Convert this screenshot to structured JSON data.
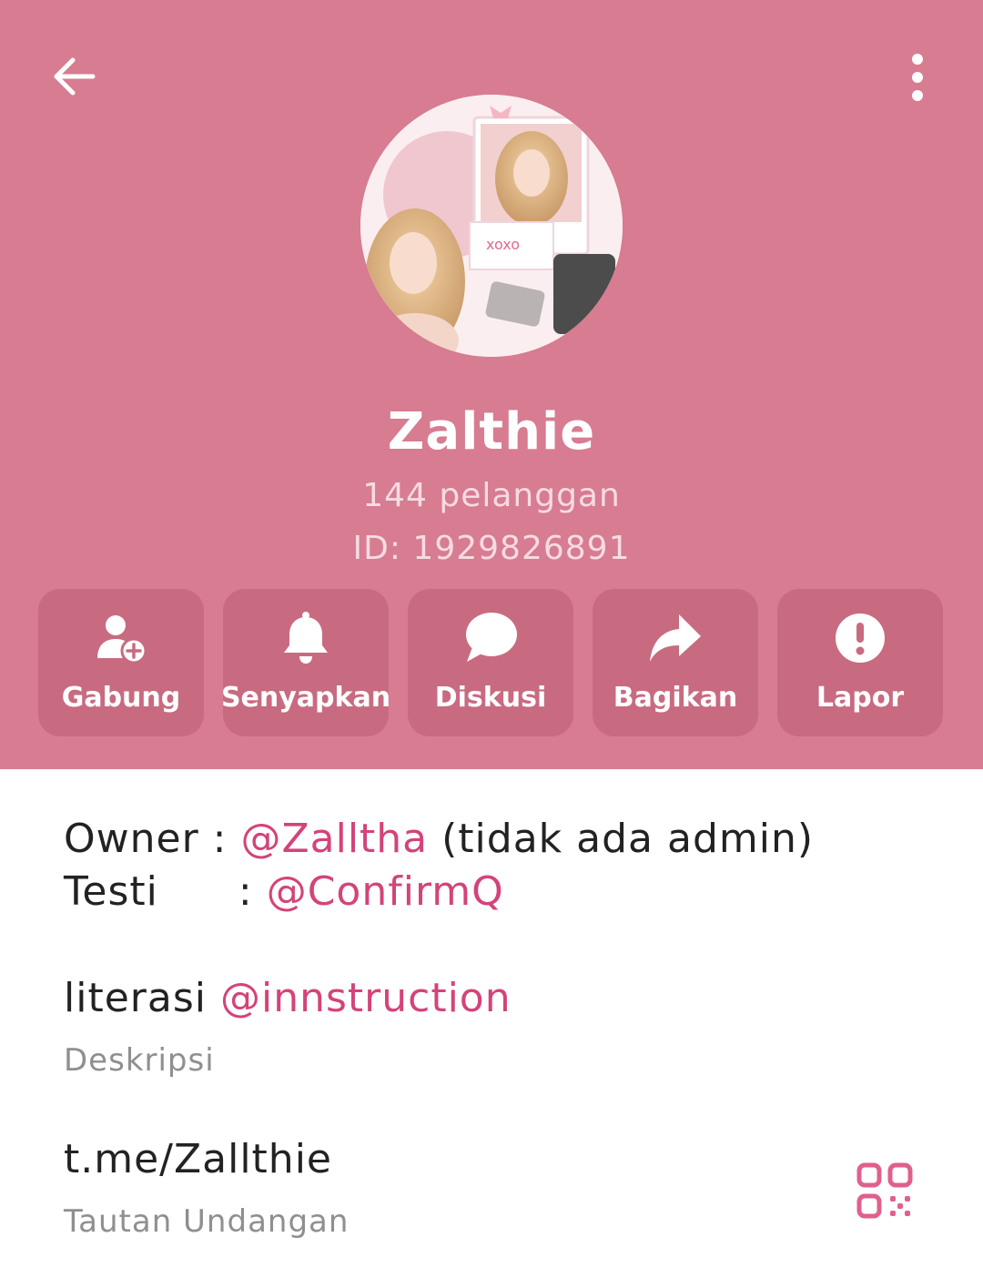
{
  "channel": {
    "name": "Zalthie",
    "subscribers": "144 pelanggan",
    "id_text": "ID: 1929826891"
  },
  "toolbar": {
    "back_icon": "arrow-left-icon",
    "more_icon": "more-vertical-icon"
  },
  "actions": [
    {
      "label": "Gabung",
      "icon": "add-user-icon"
    },
    {
      "label": "Senyapkan",
      "icon": "bell-icon"
    },
    {
      "label": "Diskusi",
      "icon": "chat-bubble-icon"
    },
    {
      "label": "Bagikan",
      "icon": "share-arrow-icon"
    },
    {
      "label": "Lapor",
      "icon": "alert-icon"
    }
  ],
  "description": {
    "owner_label": "Owner :",
    "owner_link": "@Zalltha",
    "owner_note": "(tidak ada admin)",
    "testi_label": "Testi",
    "testi_colon": ":",
    "testi_link": "@ConfirmQ",
    "literasi_label": "literasi",
    "literasi_link": "@innstruction",
    "caption": "Deskripsi"
  },
  "invite": {
    "link": "t.me/Zallthie",
    "caption": "Tautan Undangan",
    "qr_icon": "qr-code-icon"
  },
  "colors": {
    "header_bg": "#d77c91",
    "button_bg": "#c86b80",
    "link": "#d4437a"
  }
}
